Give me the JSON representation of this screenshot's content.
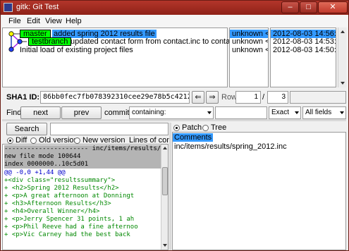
{
  "window": {
    "title": "gitk: Git Test",
    "min_label": "–",
    "max_label": "□",
    "close_label": "✕"
  },
  "menu": [
    "File",
    "Edit",
    "View",
    "Help"
  ],
  "commits": [
    {
      "branch": "master",
      "subject": "added spring 2012 results file",
      "author": "unknown <r",
      "date": "2012-08-03 14:56:47",
      "selected": true
    },
    {
      "branch": "testbranch",
      "subject": "updated contact form from contact.inc to contact.php",
      "author": "unknown <r",
      "date": "2012-08-03 14:53:38",
      "selected": false
    },
    {
      "branch": "",
      "subject": "Initial load of existing project files",
      "author": "unknown <r",
      "date": "2012-08-03 14:50:41",
      "selected": false
    }
  ],
  "sha": {
    "label": "SHA1 ID:",
    "value": "86bb0fec7fb078392310cee29e78b5c421258a0d",
    "row_label": "Row",
    "row_current": "1",
    "row_sep": "/",
    "row_total": "3"
  },
  "find": {
    "label": "Find",
    "next": "next",
    "prev": "prev",
    "commit_label": "commit",
    "mode": "containing:",
    "match": "Exact",
    "fields": "All fields"
  },
  "search": {
    "button": "Search"
  },
  "diff_options": {
    "diff": "Diff",
    "old": "Old version",
    "new": "New version",
    "context": "Lines of contex"
  },
  "diff_lines": [
    {
      "text": "---------------------- inc/items/results/",
      "kind": "header"
    },
    {
      "text": "new file mode 100644",
      "kind": "header"
    },
    {
      "text": "index 0000000..10c5d01",
      "kind": "header"
    },
    {
      "text": "@@ -0,0 +1,44 @@",
      "kind": "hunk"
    },
    {
      "text": "+<div class=\"resultssummary\">",
      "kind": "add"
    },
    {
      "text": "+       <h2>Spring 2012 Results</h2>",
      "kind": "add"
    },
    {
      "text": "+       <p>A great afternoon at Donningt",
      "kind": "add"
    },
    {
      "text": "+       <h3>Afternoon Results</h3>",
      "kind": "add"
    },
    {
      "text": "+       <h4>Overall Winner</h4>",
      "kind": "add"
    },
    {
      "text": "+       <p>Jerry Spencer 31 points, 1 ah",
      "kind": "add"
    },
    {
      "text": "+       <p>Phil Reeve had a fine afternoo",
      "kind": "add"
    },
    {
      "text": "+       <p>Vic Carney had the best back",
      "kind": "add"
    }
  ],
  "tree_options": {
    "patch": "Patch",
    "tree": "Tree"
  },
  "file_list": {
    "comments": "Comments",
    "file": "inc/items/results/spring_2012.inc"
  },
  "colors": {
    "branch_bg": "#00ff00",
    "selection": "#3399ff",
    "add_text": "#008800",
    "hunk_text": "#0000cc",
    "header_bg": "#b4b4b4"
  }
}
